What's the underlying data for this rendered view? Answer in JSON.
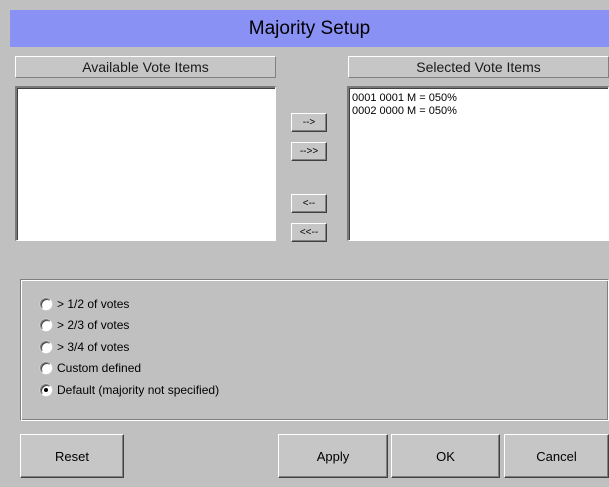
{
  "title": "Majority Setup",
  "available": {
    "header": "Available Vote Items",
    "items": []
  },
  "selected": {
    "header": "Selected Vote Items",
    "items": [
      "0001 0001 M = 050%",
      "0002 0000 M = 050%"
    ]
  },
  "arrows": {
    "add": "-->",
    "add_all": "-->>",
    "remove": "<--",
    "remove_all": "<<--"
  },
  "majority_options": [
    {
      "label": "> 1/2 of votes",
      "checked": false
    },
    {
      "label": "> 2/3 of votes",
      "checked": false
    },
    {
      "label": "> 3/4 of votes",
      "checked": false
    },
    {
      "label": "Custom defined",
      "checked": false
    },
    {
      "label": "Default (majority not specified)",
      "checked": true
    }
  ],
  "buttons": {
    "reset": "Reset",
    "apply": "Apply",
    "ok": "OK",
    "cancel": "Cancel"
  },
  "colors": {
    "title_bar": "#8a91f4",
    "background": "#c0c0c0"
  }
}
